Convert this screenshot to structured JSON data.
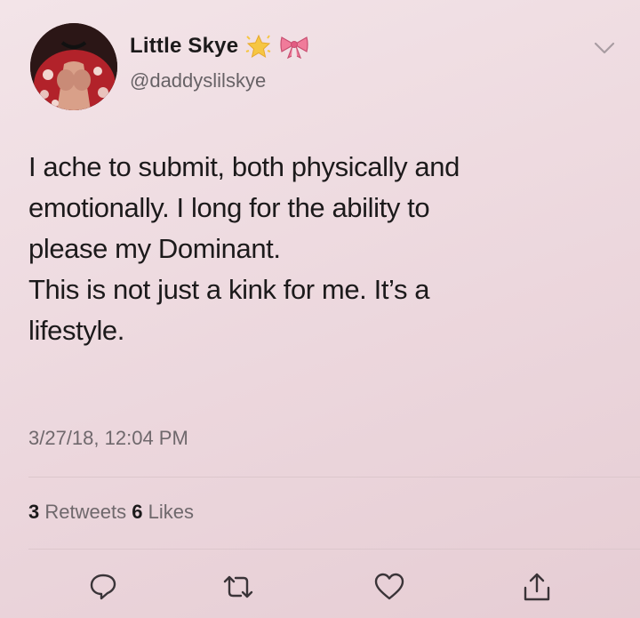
{
  "tweet": {
    "display_name": "Little Skye",
    "handle": "@daddyslilskye",
    "text": "I ache to submit, both physically and\nemotionally. I long for the ability to\nplease my Dominant.\nThis is not just a kink for me. It’s a\nlifestyle.",
    "timestamp": "3/27/18, 12:04 PM"
  },
  "stats": {
    "retweets_count": "3",
    "retweets_label": "Retweets",
    "likes_count": "6",
    "likes_label": "Likes"
  },
  "icons": {
    "name_emojis": [
      "glowing-star-icon",
      "ribbon-bow-icon"
    ],
    "menu": "chevron-down-icon",
    "actions": [
      "reply-icon",
      "retweet-icon",
      "like-heart-icon",
      "share-icon"
    ]
  },
  "colors": {
    "background": "#ecd7dd",
    "text_primary": "#1c1a1b",
    "text_secondary": "#6f686c",
    "divider": "#dcc7cc"
  }
}
